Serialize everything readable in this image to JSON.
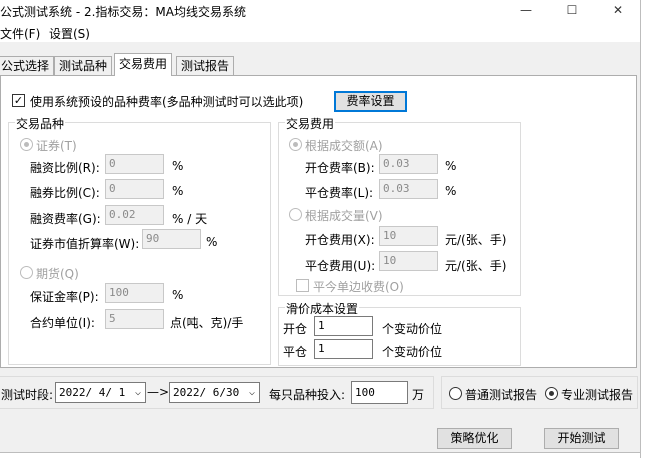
{
  "window": {
    "title": "公式测试系统 - 2.指标交易：MA均线交易系统",
    "min_icon": "—",
    "max_icon": "☐",
    "close_icon": "✕"
  },
  "menu": {
    "file": "文件(F)",
    "settings": "设置(S)"
  },
  "tabs": [
    "公式选择",
    "测试品种",
    "交易费用",
    "测试报告"
  ],
  "active_tab": "交易费用",
  "system_fee": {
    "label": "使用系统预设的品种费率(多品种测试时可以选此项)",
    "checked": true,
    "check_glyph": "✓",
    "button": "费率设置"
  },
  "variety": {
    "title": "交易品种",
    "securities": "证券(T)",
    "margin_ratio_label": "融资比例(R):",
    "margin_ratio": "0",
    "short_ratio_label": "融券比例(C):",
    "short_ratio": "0",
    "finance_rate_label": "融资费率(G):",
    "finance_rate": "0.02",
    "finance_rate_unit": "% / 天",
    "market_discount_label": "证券市值折算率(W):",
    "market_discount": "90",
    "pct": "%",
    "futures": "期货(Q)",
    "deposit_rate_label": "保证金率(P):",
    "deposit_rate": "100",
    "contract_unit_label": "合约单位(I):",
    "contract_unit": "5",
    "contract_unit_suffix": "点(吨、克)/手"
  },
  "fees": {
    "title": "交易费用",
    "by_amount": "根据成交额(A)",
    "open_rate_label": "开仓费率(B):",
    "open_rate": "0.03",
    "close_rate_label": "平仓费率(L):",
    "close_rate": "0.03",
    "pct": "%",
    "by_volume": "根据成交量(V)",
    "open_fee_label": "开仓费用(X):",
    "open_fee": "10",
    "close_fee_label": "平仓费用(U):",
    "close_fee": "10",
    "per_unit": "元/(张、手)",
    "single_side": "平今单边收费(O)"
  },
  "slippage": {
    "title": "滑价成本设置",
    "open_label": "开仓",
    "open_value": "1",
    "close_label": "平仓",
    "close_value": "1",
    "unit": "个变动价位"
  },
  "period": {
    "label": "测试时段:",
    "start": "2022/ 4/ 1",
    "arrow": "—>",
    "end": "2022/ 6/30",
    "invest_label": "每只品种投入:",
    "invest_value": "100",
    "invest_unit": "万",
    "dropdown_arrow": "⌵"
  },
  "report": {
    "normal": "普通测试报告",
    "pro": "专业测试报告",
    "selected": "专业测试报告"
  },
  "actions": {
    "optimize": "策略优化",
    "start": "开始测试"
  }
}
